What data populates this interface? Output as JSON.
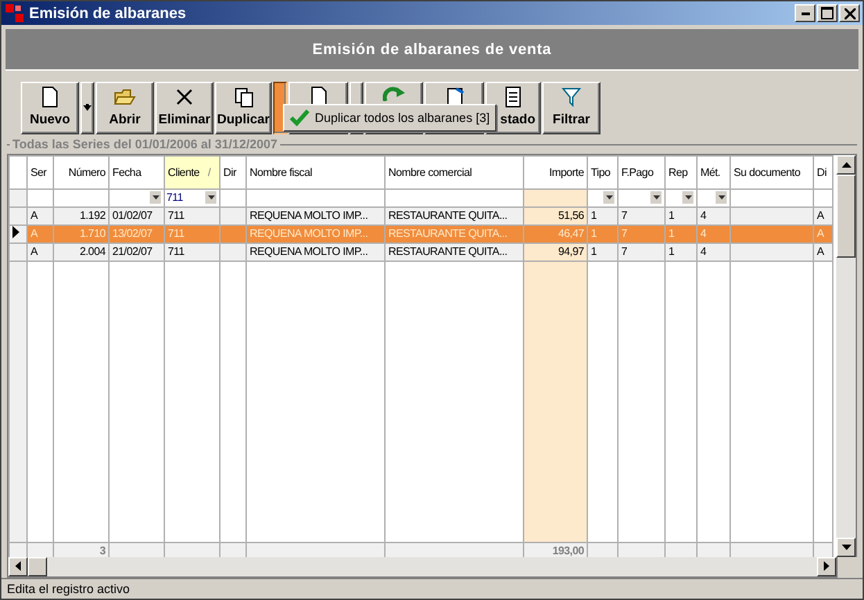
{
  "window": {
    "title": "Emisión de albaranes"
  },
  "header_title": "Emisión de albaranes de venta",
  "toolbar": [
    {
      "kind": "new",
      "label": "Nuevo"
    },
    {
      "kind": "split",
      "active": false,
      "arrow": true
    },
    {
      "kind": "open",
      "label": "Abrir"
    },
    {
      "kind": "delete",
      "label": "Eliminar"
    },
    {
      "kind": "duplicate",
      "label": "Duplicar"
    },
    {
      "kind": "split",
      "active": true
    },
    {
      "kind": "document"
    },
    {
      "kind": "split",
      "active": false
    },
    {
      "kind": "refresh"
    },
    {
      "kind": "export"
    },
    {
      "kind": "list",
      "label": "stado"
    },
    {
      "kind": "filter",
      "label": "Filtrar"
    }
  ],
  "popup_menu": {
    "items": [
      {
        "label": "Duplicar todos los albaranes [3]",
        "checked": true
      }
    ]
  },
  "group_label": "Todas las Series  del 01/01/2006 al 31/12/2007",
  "columns": [
    {
      "label": "Ser",
      "sorted": false
    },
    {
      "label": "Número",
      "sorted": false
    },
    {
      "label": "Fecha",
      "sorted": false,
      "filter": {
        "kind": "dropdown"
      }
    },
    {
      "label": "Cliente",
      "sorted": true,
      "sort_mark": "/",
      "filter": {
        "kind": "dropdown",
        "value": "711"
      }
    },
    {
      "label": "Dir",
      "sorted": false
    },
    {
      "label": "Nombre fiscal",
      "sorted": false
    },
    {
      "label": "Nombre comercial",
      "sorted": false
    },
    {
      "label": "Importe",
      "sorted": false
    },
    {
      "label": "Tipo",
      "sorted": false,
      "filter": {
        "kind": "dropdown"
      }
    },
    {
      "label": "F.Pago",
      "sorted": false,
      "filter": {
        "kind": "dropdown"
      }
    },
    {
      "label": "Rep",
      "sorted": false,
      "filter": {
        "kind": "dropdown"
      }
    },
    {
      "label": "Mét.",
      "sorted": false,
      "filter": {
        "kind": "dropdown"
      }
    },
    {
      "label": "Su documento",
      "sorted": false
    },
    {
      "label": "Di",
      "sorted": false
    }
  ],
  "rows": [
    {
      "selected": false,
      "cells": [
        "A",
        "1.192",
        "01/02/07",
        "711",
        "",
        "REQUENA MOLTO IMP...",
        "RESTAURANTE QUITA...",
        "51,56",
        "1",
        "7",
        "1",
        "4",
        "",
        "A"
      ]
    },
    {
      "selected": true,
      "cells": [
        "A",
        "1.710",
        "13/02/07",
        "711",
        "",
        "REQUENA MOLTO IMP...",
        "RESTAURANTE QUITA...",
        "46,47",
        "1",
        "7",
        "1",
        "4",
        "",
        "A"
      ]
    },
    {
      "selected": false,
      "cells": [
        "A",
        "2.004",
        "21/02/07",
        "711",
        "",
        "REQUENA MOLTO IMP...",
        "RESTAURANTE QUITA...",
        "94,97",
        "1",
        "7",
        "1",
        "4",
        "",
        "A"
      ]
    }
  ],
  "footer": {
    "count": "3",
    "total": "193,00"
  },
  "status_bar": "Edita el registro activo"
}
